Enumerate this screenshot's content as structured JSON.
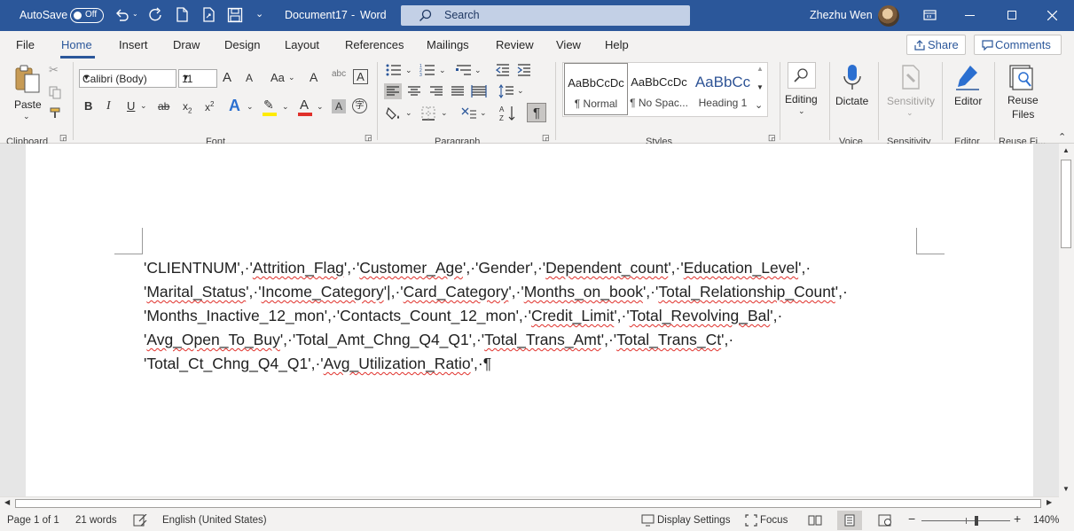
{
  "titlebar": {
    "autosave_label": "AutoSave",
    "autosave_state": "Off",
    "document_title": "Document17",
    "separator": "-",
    "app_name": "Word",
    "search_placeholder": "Search",
    "user_name": "Zhezhu Wen"
  },
  "tabs": {
    "file": "File",
    "home": "Home",
    "insert": "Insert",
    "draw": "Draw",
    "design": "Design",
    "layout": "Layout",
    "references": "References",
    "mailings": "Mailings",
    "review": "Review",
    "view": "View",
    "help": "Help",
    "share": "Share",
    "comments": "Comments"
  },
  "ribbon": {
    "clipboard": {
      "paste_label": "Paste",
      "group_label": "Clipboard"
    },
    "font": {
      "font_name": "Calibri (Body)",
      "font_size": "11",
      "group_label": "Font",
      "change_case": "Aa",
      "bold": "B",
      "italic": "I",
      "underline": "U",
      "strikethrough": "ab",
      "subscript": "x",
      "superscript": "x",
      "grow_font": "A",
      "shrink_font": "A",
      "clear_formatting": "A",
      "text_box": "A",
      "text_effects": "A",
      "font_color": "A",
      "shading": "A"
    },
    "paragraph": {
      "group_label": "Paragraph"
    },
    "styles": {
      "group_label": "Styles",
      "items": [
        {
          "preview": "AaBbCcDc",
          "name": "¶ Normal"
        },
        {
          "preview": "AaBbCcDc",
          "name": "¶ No Spac..."
        },
        {
          "preview": "AaBbCc",
          "name": "Heading 1"
        }
      ]
    },
    "editing": {
      "label": "Editing"
    },
    "voice": {
      "dictate_label": "Dictate",
      "group_label": "Voice"
    },
    "sensitivity": {
      "label": "Sensitivity",
      "group_label": "Sensitivity"
    },
    "editor": {
      "label": "Editor",
      "group_label": "Editor"
    },
    "reuse": {
      "label_line1": "Reuse",
      "label_line2": "Files",
      "group_label": "Reuse Fi..."
    }
  },
  "document": {
    "lines": [
      {
        "segments": [
          {
            "t": "'CLIENTNUM',·'",
            "sq": false
          },
          {
            "t": "Attrition_Flag",
            "sq": true
          },
          {
            "t": "',·'",
            "sq": false
          },
          {
            "t": "Customer_Age",
            "sq": true
          },
          {
            "t": "',·'Gender',·'",
            "sq": false
          },
          {
            "t": "Dependent_count",
            "sq": true
          },
          {
            "t": "',·'",
            "sq": false
          },
          {
            "t": "Education_Level",
            "sq": true
          },
          {
            "t": "',·",
            "sq": false
          }
        ]
      },
      {
        "segments": [
          {
            "t": "'",
            "sq": false
          },
          {
            "t": "Marital_Status",
            "sq": true
          },
          {
            "t": "',·'",
            "sq": false
          },
          {
            "t": "Income_Category",
            "sq": true
          },
          {
            "t": "'|,·'",
            "sq": false
          },
          {
            "t": "Card_Category",
            "sq": true
          },
          {
            "t": "',·'",
            "sq": false
          },
          {
            "t": "Months_on_book",
            "sq": true
          },
          {
            "t": "',·'",
            "sq": false
          },
          {
            "t": "Total_Relationship_Count",
            "sq": true
          },
          {
            "t": "',·",
            "sq": false
          }
        ]
      },
      {
        "segments": [
          {
            "t": "'Months_Inactive_12_mon',·'Contacts_Count_12_mon',·'",
            "sq": false
          },
          {
            "t": "Credit_Limit",
            "sq": true
          },
          {
            "t": "',·'",
            "sq": false
          },
          {
            "t": "Total_Revolving_Bal",
            "sq": true
          },
          {
            "t": "',·",
            "sq": false
          }
        ]
      },
      {
        "segments": [
          {
            "t": "'",
            "sq": false
          },
          {
            "t": "Avg_Open_To_Buy",
            "sq": true
          },
          {
            "t": "',·'Total_Amt_Chng_Q4_Q1',·'",
            "sq": false
          },
          {
            "t": "Total_Trans_Amt",
            "sq": true
          },
          {
            "t": "',·'",
            "sq": false
          },
          {
            "t": "Total_Trans_Ct",
            "sq": true
          },
          {
            "t": "',·",
            "sq": false
          }
        ]
      },
      {
        "segments": [
          {
            "t": "'Total_Ct_Chng_Q4_Q1',·'",
            "sq": false
          },
          {
            "t": "Avg_Utilization_Ratio",
            "sq": true
          },
          {
            "t": "',·¶",
            "sq": false
          }
        ]
      }
    ]
  },
  "statusbar": {
    "page": "Page 1 of 1",
    "words": "21 words",
    "language": "English (United States)",
    "display_settings": "Display Settings",
    "focus": "Focus",
    "zoom_minus": "−",
    "zoom_plus": "+",
    "zoom": "140%",
    "zoom_fraction": 0.62
  },
  "colors": {
    "title_bar": "#2b579a",
    "accent": "#2b579a",
    "spell_squiggle": "#e0302a"
  }
}
